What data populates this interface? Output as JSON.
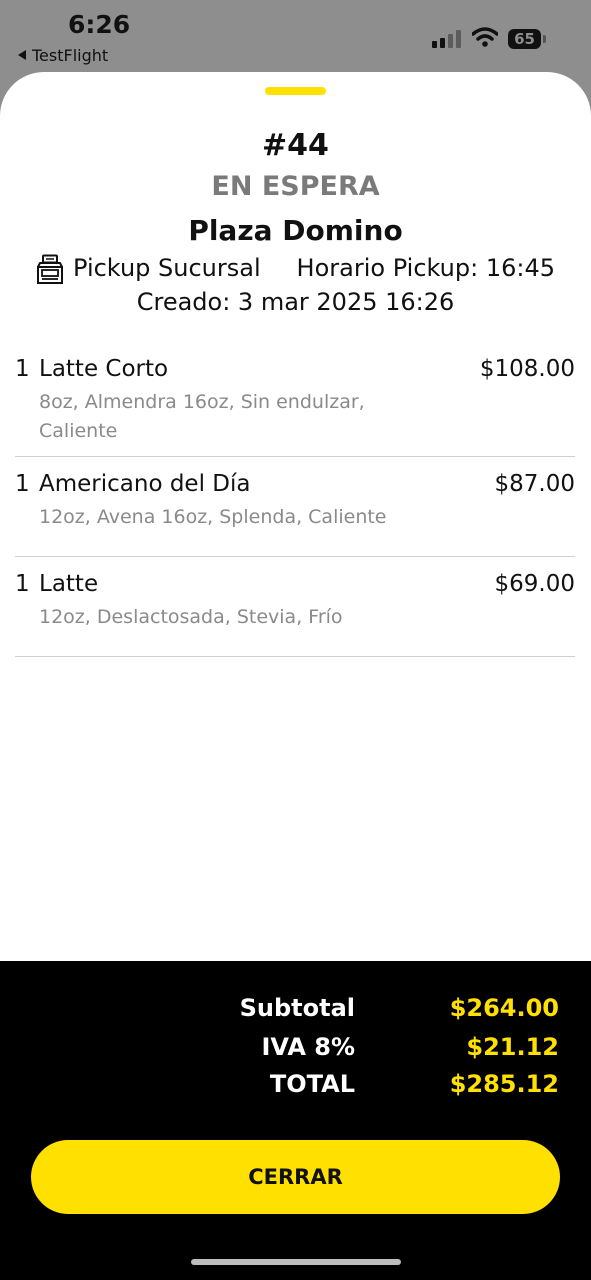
{
  "status_bar": {
    "time": "6:26",
    "back_app": "TestFlight",
    "battery": "65"
  },
  "order": {
    "number": "#44",
    "status": "EN ESPERA",
    "store": "Plaza Domino",
    "pickup_type": "Pickup Sucursal",
    "pickup_time": "Horario Pickup: 16:45",
    "created": "Creado: 3 mar 2025 16:26",
    "icon": "store-icon"
  },
  "items": [
    {
      "qty": "1",
      "name": "Latte Corto",
      "price": "$108.00",
      "mods": "8oz, Almendra 16oz, Sin endulzar, Caliente"
    },
    {
      "qty": "1",
      "name": "Americano del Día",
      "price": "$87.00",
      "mods": "12oz, Avena 16oz, Splenda, Caliente"
    },
    {
      "qty": "1",
      "name": "Latte",
      "price": "$69.00",
      "mods": "12oz, Deslactosada, Stevia, Frío"
    }
  ],
  "totals": {
    "subtotal_label": "Subtotal",
    "subtotal": "$264.00",
    "iva_label": "IVA 8%",
    "iva": "$21.12",
    "total_label": "TOTAL",
    "total": "$285.12"
  },
  "close_button": "CERRAR",
  "colors": {
    "accent": "#ffe000",
    "footer_bg": "#000000",
    "muted_text": "#7a7a7a"
  }
}
